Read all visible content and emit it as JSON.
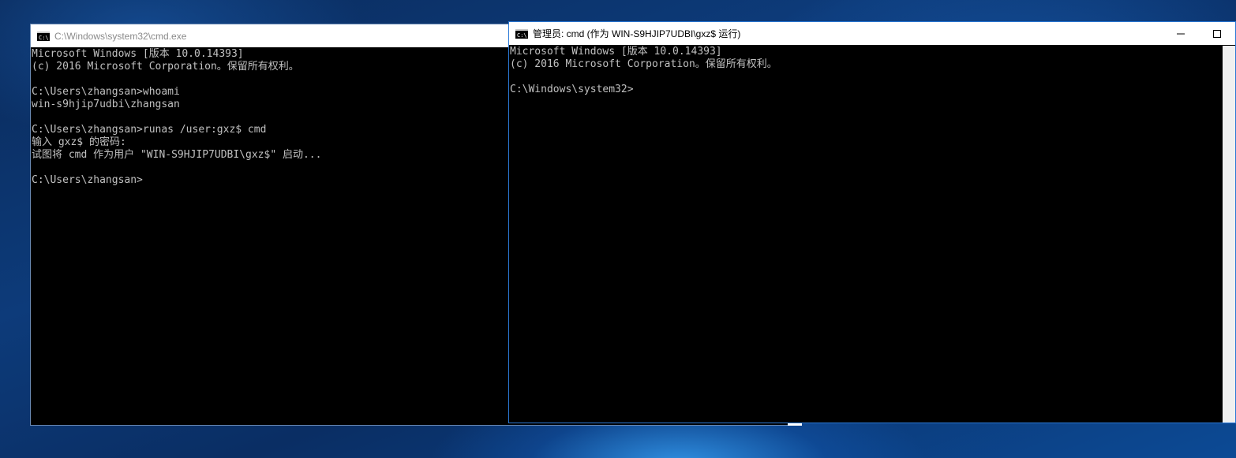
{
  "left_window": {
    "icon": "cmd-icon",
    "title": "C:\\Windows\\system32\\cmd.exe",
    "console_lines": [
      "Microsoft Windows [版本 10.0.14393]",
      "(c) 2016 Microsoft Corporation。保留所有权利。",
      "",
      "C:\\Users\\zhangsan>whoami",
      "win-s9hjip7udbi\\zhangsan",
      "",
      "C:\\Users\\zhangsan>runas /user:gxz$ cmd",
      "输入 gxz$ 的密码:",
      "试图将 cmd 作为用户 \"WIN-S9HJIP7UDBI\\gxz$\" 启动...",
      "",
      "C:\\Users\\zhangsan>"
    ]
  },
  "right_window": {
    "icon": "cmd-icon",
    "title": "管理员: cmd (作为 WIN-S9HJIP7UDBI\\gxz$ 运行)",
    "minimize_icon": "minimize-icon",
    "maximize_icon": "maximize-icon",
    "console_lines": [
      "Microsoft Windows [版本 10.0.14393]",
      "(c) 2016 Microsoft Corporation。保留所有权利。",
      "",
      "C:\\Windows\\system32>"
    ]
  },
  "colors": {
    "console_bg": "#000000",
    "console_text": "#c0c0c0",
    "active_border": "#2b79d6",
    "inactive_title_text": "#8a8a8a"
  }
}
